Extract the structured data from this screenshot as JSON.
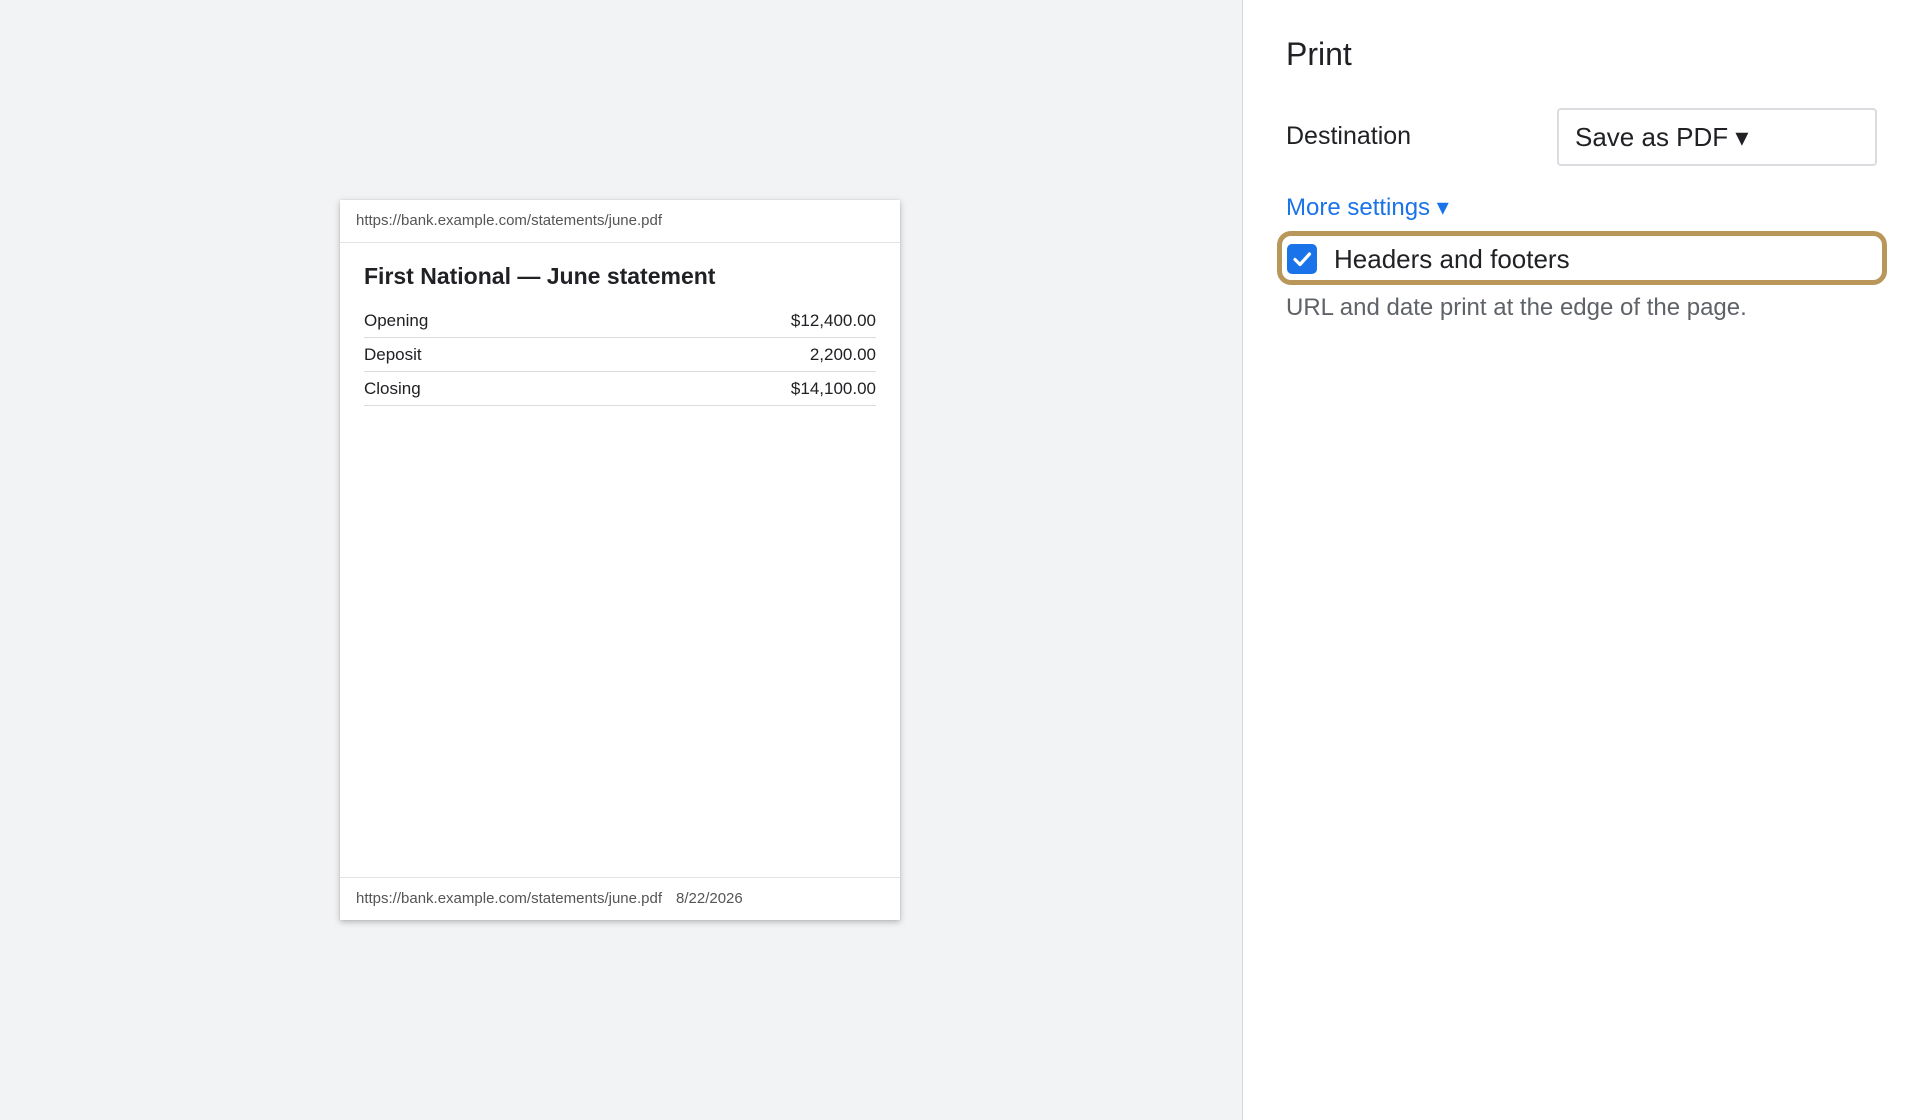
{
  "preview": {
    "header_url": "https://bank.example.com/statements/june.pdf",
    "footer_url": "https://bank.example.com/statements/june.pdf",
    "footer_date": "8/22/2026",
    "document": {
      "title": "First National — June statement",
      "rows": [
        {
          "label": "Opening",
          "amount": "$12,400.00"
        },
        {
          "label": "Deposit",
          "amount": "2,200.00"
        },
        {
          "label": "Closing",
          "amount": "$14,100.00"
        }
      ]
    }
  },
  "settings": {
    "title": "Print",
    "destination_label": "Destination",
    "destination_value": "Save as PDF ▾",
    "more_settings_label": "More settings ▾",
    "headers_footers_label": "Headers and footers",
    "headers_footers_checked": true,
    "headers_footers_description": "URL and date print at the edge of the page.",
    "checkbox_icon": "checkmark-icon",
    "colors": {
      "accent": "#1a73e8",
      "highlight_border": "#b9975b"
    }
  }
}
